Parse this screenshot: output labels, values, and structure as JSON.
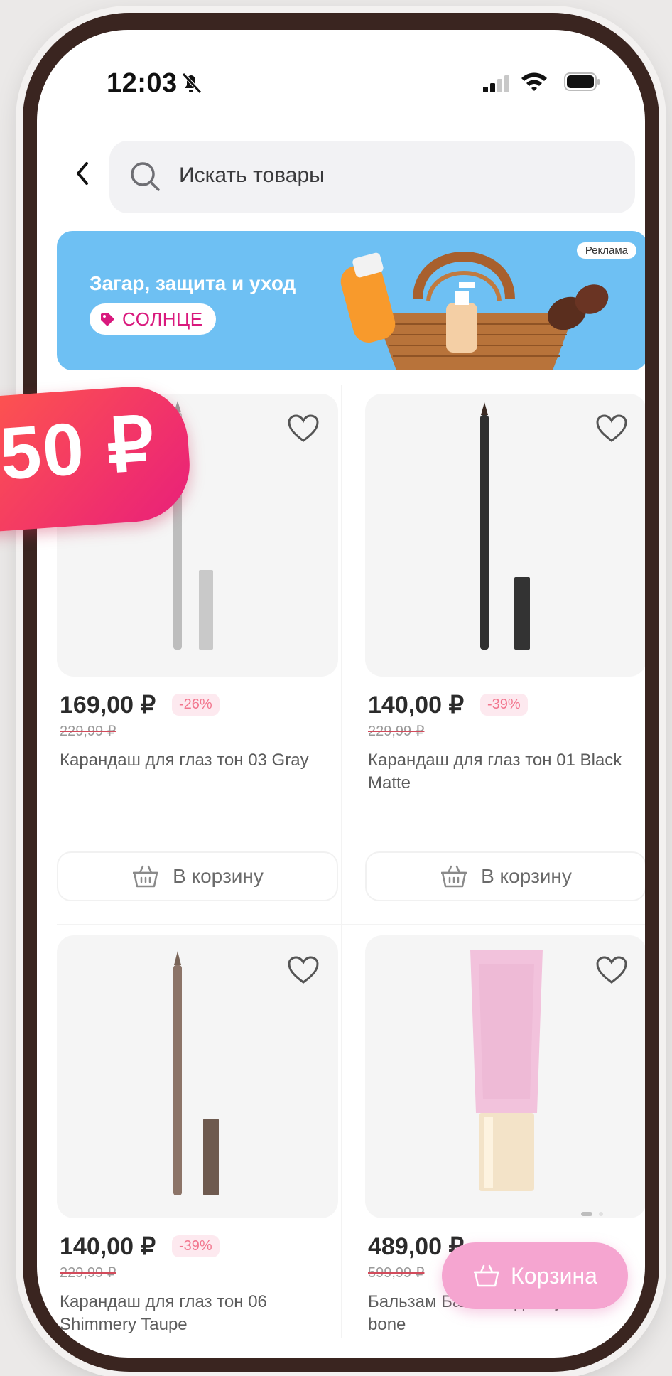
{
  "status_bar": {
    "time": "12:03"
  },
  "search": {
    "placeholder": "Искать товары"
  },
  "banner": {
    "title": "Загар, защита и уход",
    "promo_code": "СОЛНЦЕ",
    "ad_label": "Реклама"
  },
  "products": [
    {
      "price": "169,00 ₽",
      "discount": "-26%",
      "old_price": "229,99 ₽",
      "name": "Карандаш для глаз тон 03 Gray",
      "cart_label": "В корзину"
    },
    {
      "price": "140,00 ₽",
      "discount": "-39%",
      "old_price": "229,99 ₽",
      "name": "Карандаш для глаз тон 01 Black Matte",
      "cart_label": "В корзину"
    },
    {
      "price": "140,00 ₽",
      "discount": "-39%",
      "old_price": "229,99 ₽",
      "name": "Карандаш для глаз тон 06 Shimmery Taupe"
    },
    {
      "price": "489,00 ₽",
      "old_price": "599,99 ₽",
      "name": "Бальзам Бальзам для губ Bon-bone"
    }
  ],
  "floating_cart": {
    "label": "Корзина"
  },
  "price_badge": {
    "text": "50 ₽"
  },
  "colors": {
    "accent_pink": "#f5a5d0",
    "banner_blue": "#6ec0f3",
    "discount_pink": "#f2768e",
    "badge_red": "#f0306c"
  }
}
